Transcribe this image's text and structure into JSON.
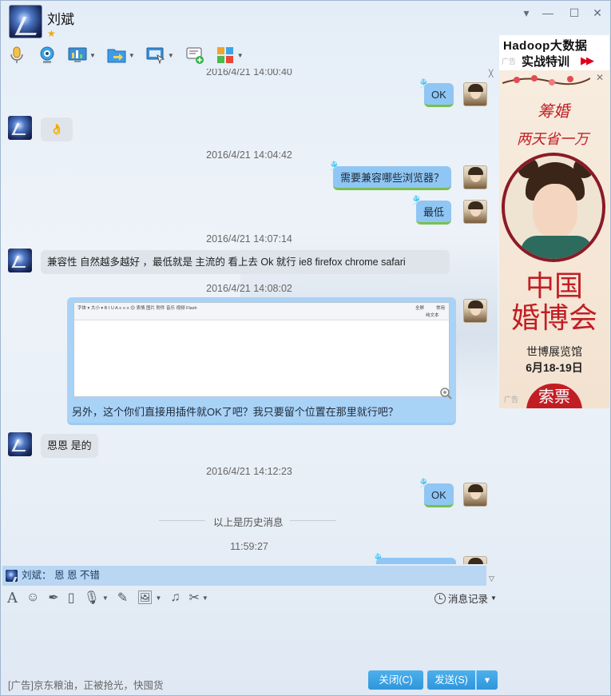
{
  "window": {
    "contact_name": "刘斌",
    "star": "★",
    "controls": {
      "minimize": "▾",
      "restore": "—",
      "maximize": "☐",
      "close": "✕"
    }
  },
  "toolbar": {
    "items": [
      {
        "name": "voice-call",
        "icon": "microphone-icon"
      },
      {
        "name": "video-call",
        "icon": "webcam-icon"
      },
      {
        "name": "screen-share",
        "icon": "monitor-chart-icon"
      },
      {
        "name": "file-transfer",
        "icon": "folder-arrow-icon"
      },
      {
        "name": "remote-desktop",
        "icon": "remote-screen-icon"
      },
      {
        "name": "add-member",
        "icon": "chat-add-icon"
      },
      {
        "name": "apps",
        "icon": "apps-grid-icon"
      }
    ]
  },
  "messages": [
    {
      "type": "timestamp",
      "text": "2016/4/21 14:00:40"
    },
    {
      "type": "out",
      "text": "OK"
    },
    {
      "type": "in",
      "text": "👌"
    },
    {
      "type": "timestamp",
      "text": "2016/4/21 14:04:42"
    },
    {
      "type": "out",
      "text": "需要兼容哪些浏览器？"
    },
    {
      "type": "out",
      "text": "最低"
    },
    {
      "type": "timestamp",
      "text": "2016/4/21 14:07:14"
    },
    {
      "type": "in",
      "text": "兼容性 自然越多越好 ，最低就是 主流的 看上去 Ok 就行 ie8 firefox chrome safari"
    },
    {
      "type": "timestamp",
      "text": "2016/4/21 14:08:02"
    },
    {
      "type": "out-image",
      "text": "另外，这个你们直接用插件就OK了吧？我只要留个位置在那里就行吧？"
    },
    {
      "type": "in",
      "text": "恩恩 是的"
    },
    {
      "type": "timestamp",
      "text": "2016/4/21 14:12:23"
    },
    {
      "type": "out",
      "text": "OK"
    },
    {
      "type": "divider",
      "text": "以上是历史消息"
    },
    {
      "type": "timestamp",
      "text": "11:59:27"
    }
  ],
  "embedded_editor": {
    "row1": "字体 ▾  大小 ▾  B I U A  ≡ ≡ ≡  😊 表情 图片 附件 音乐 视频 Flash",
    "fullscreen": "全屏",
    "common": "常用",
    "plaintext": "纯文本"
  },
  "notice": {
    "text": "刘斌： 恩 恩  不错"
  },
  "input_toolbar": {
    "history_label": "消息记录"
  },
  "bottom": {
    "ad_text": "[广告]京东粮油，正被抢光，快囤货",
    "close_label": "关闭(C)",
    "send_label": "发送(S)",
    "send_more": "▾"
  },
  "ads": {
    "top": {
      "line1": "Hadoop大数据",
      "line2": "实战特训",
      "tag": "广告",
      "arrows": "▶▶"
    },
    "side": {
      "close": "✕",
      "line1": "筹婚",
      "line2": "两天省一万",
      "line3a": "中国",
      "line3b": "婚博会",
      "venue": "世博展览馆",
      "date": "6月18-19日",
      "tag": "广告",
      "button": "索票"
    }
  }
}
